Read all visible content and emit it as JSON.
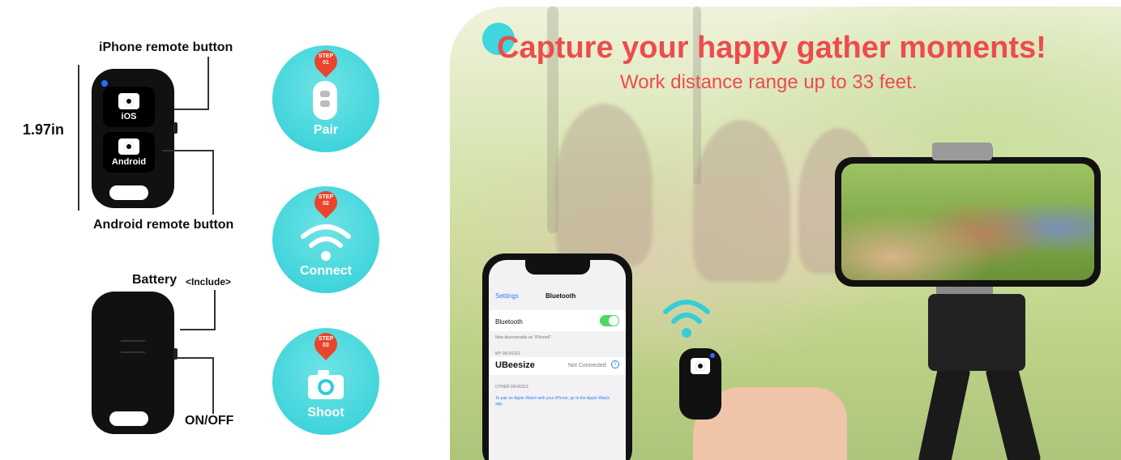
{
  "labels": {
    "iphone_button": "iPhone remote button",
    "size": "1.97in",
    "android_button": "Android remote button",
    "battery": "Battery",
    "battery_note": "<Include>",
    "onoff": "ON/OFF"
  },
  "remote": {
    "ios_text": "iOS",
    "android_text": "Android"
  },
  "steps": [
    {
      "tag": "STEP",
      "num": "01",
      "name": "Pair"
    },
    {
      "tag": "STEP",
      "num": "02",
      "name": "Connect"
    },
    {
      "tag": "STEP",
      "num": "03",
      "name": "Shoot"
    }
  ],
  "banner": {
    "headline": "Capture your happy gather moments!",
    "subline": "Work distance range up to 33 feet."
  },
  "phone": {
    "back": "Settings",
    "title": "Bluetooth",
    "bluetooth_label": "Bluetooth",
    "discoverable": "Now discoverable as “iPhone6”.",
    "my_devices": "MY DEVICES",
    "device_name": "UBeesize",
    "device_status": "Not Connected",
    "other_devices": "OTHER DEVICES",
    "watch_note": "To pair an Apple Watch with your iPhone, go to the Apple Watch app."
  },
  "colors": {
    "accent": "#2ecfd6",
    "headline": "#ee4b4b",
    "step_pin": "#e8452c"
  }
}
